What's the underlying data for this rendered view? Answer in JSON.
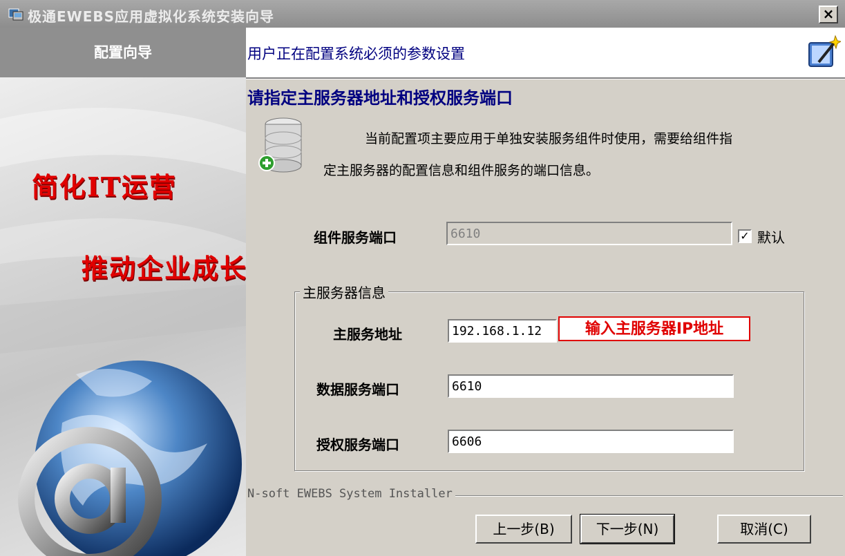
{
  "window": {
    "title": "极通EWEBS应用虚拟化系统安装向导",
    "close_label": "×"
  },
  "sidebar": {
    "header": "配置向导",
    "slogan_line1": "简化IT运营",
    "slogan_line2": "推动企业成长",
    "icons": [
      "globe-image",
      "at-sign-image"
    ]
  },
  "header": {
    "subtitle": "用户正在配置系统必须的参数设置",
    "icon": "wizard-icon"
  },
  "page": {
    "section_title": "请指定主服务器地址和授权服务端口",
    "description_line1": "当前配置项主要应用于单独安装服务组件时使用，需要给组件指",
    "description_line2": "定主服务器的配置信息和组件服务的端口信息。",
    "icon": "database-add-icon"
  },
  "form": {
    "component_port_label": "组件服务端口",
    "component_port_value": "6610",
    "default_checkbox_label": "默认",
    "default_checked": true,
    "group_label": "主服务器信息",
    "main_server_label": "主服务地址",
    "main_server_value": "192.168.1.12",
    "data_port_label": "数据服务端口",
    "data_port_value": "6610",
    "auth_port_label": "授权服务端口",
    "auth_port_value": "6606"
  },
  "annotation": {
    "text": "输入主服务器IP地址",
    "color": "#e00000"
  },
  "footer": {
    "installer_text": "N-soft EWEBS System Installer",
    "back_label": "上一步(B)",
    "next_label": "下一步(N)",
    "cancel_label": "取消(C)"
  }
}
